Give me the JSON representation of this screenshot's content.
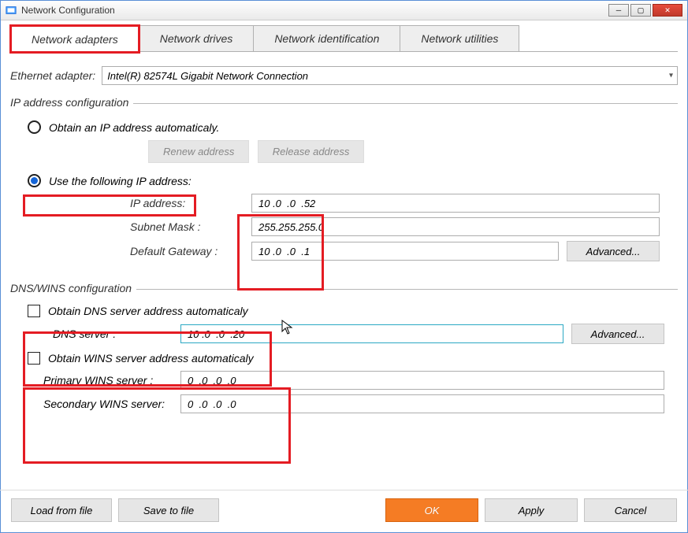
{
  "window": {
    "title": "Network Configuration"
  },
  "tabs": {
    "adapters": "Network adapters",
    "drives": "Network drives",
    "identification": "Network identification",
    "utilities": "Network utilities"
  },
  "adapter": {
    "label": "Ethernet adapter:",
    "value": "Intel(R) 82574L Gigabit Network Connection"
  },
  "ipconfig": {
    "title": "IP address configuration",
    "auto_label": "Obtain an IP address automaticaly.",
    "renew": "Renew address",
    "release": "Release address",
    "manual_label": "Use the following IP address:",
    "ip_label": "IP address:",
    "ip_value": "10 .0  .0  .52",
    "mask_label": "Subnet Mask :",
    "mask_value": "255.255.255.0",
    "gw_label": "Default Gateway :",
    "gw_value": "10 .0  .0  .1",
    "advanced": "Advanced..."
  },
  "dns": {
    "title": "DNS/WINS configuration",
    "auto_dns_label": "Obtain DNS server address automaticaly",
    "dns_label": "DNS server :",
    "dns_value": "10 .0  .0  .20",
    "advanced": "Advanced...",
    "auto_wins_label": "Obtain WINS server address automaticaly",
    "wins1_label": "Primary WINS server :",
    "wins1_value": "0  .0  .0  .0",
    "wins2_label": "Secondary WINS server:",
    "wins2_value": "0  .0  .0  .0"
  },
  "footer": {
    "load": "Load from file",
    "save": "Save to file",
    "ok": "OK",
    "apply": "Apply",
    "cancel": "Cancel"
  }
}
